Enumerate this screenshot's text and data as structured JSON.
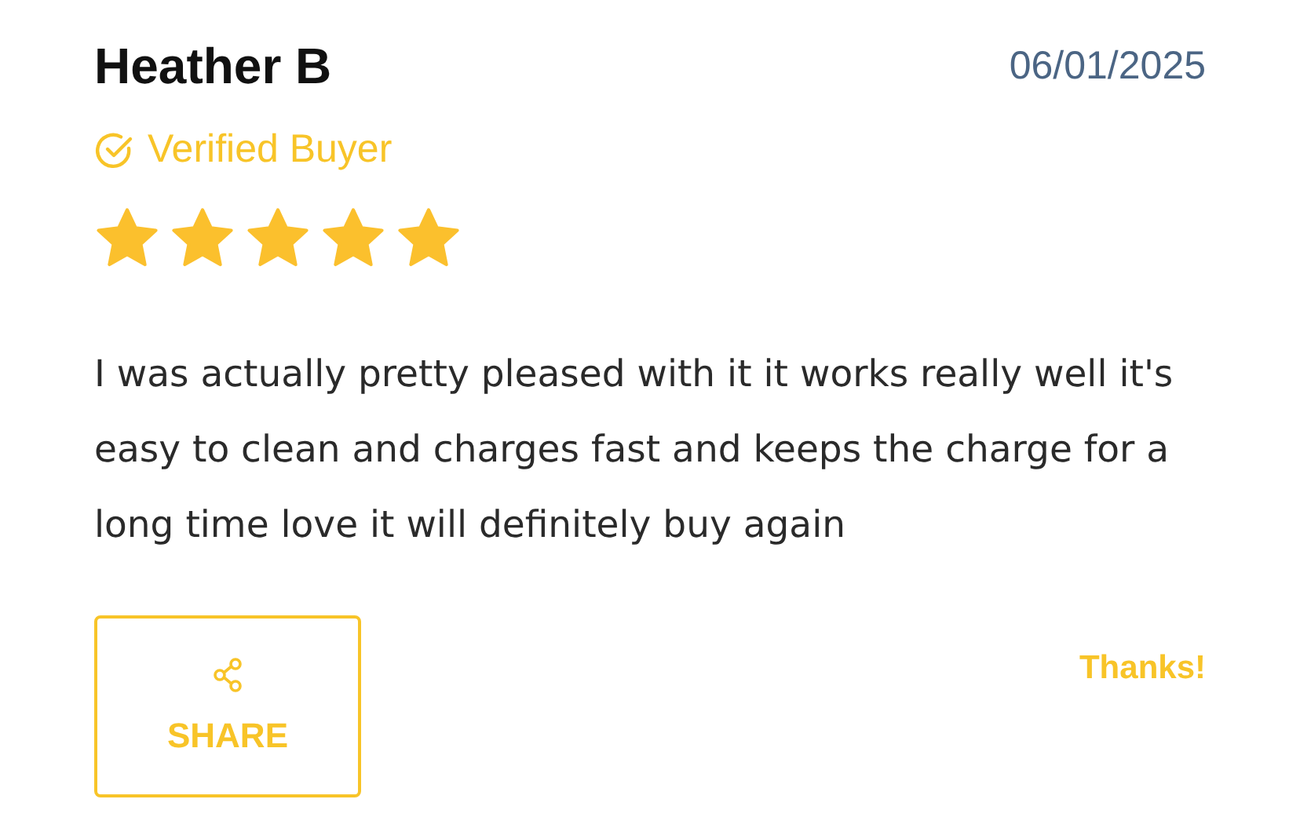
{
  "review": {
    "author": "Heather B",
    "date": "06/01/2025",
    "badge": "Verified Buyer",
    "stars": 5,
    "text": "I was actually pretty pleased with it it works really well it's easy to clean and charges fast and keeps the charge for a long time love it will definitely buy again"
  },
  "actions": {
    "share": "SHARE",
    "thanks": "Thanks!"
  }
}
